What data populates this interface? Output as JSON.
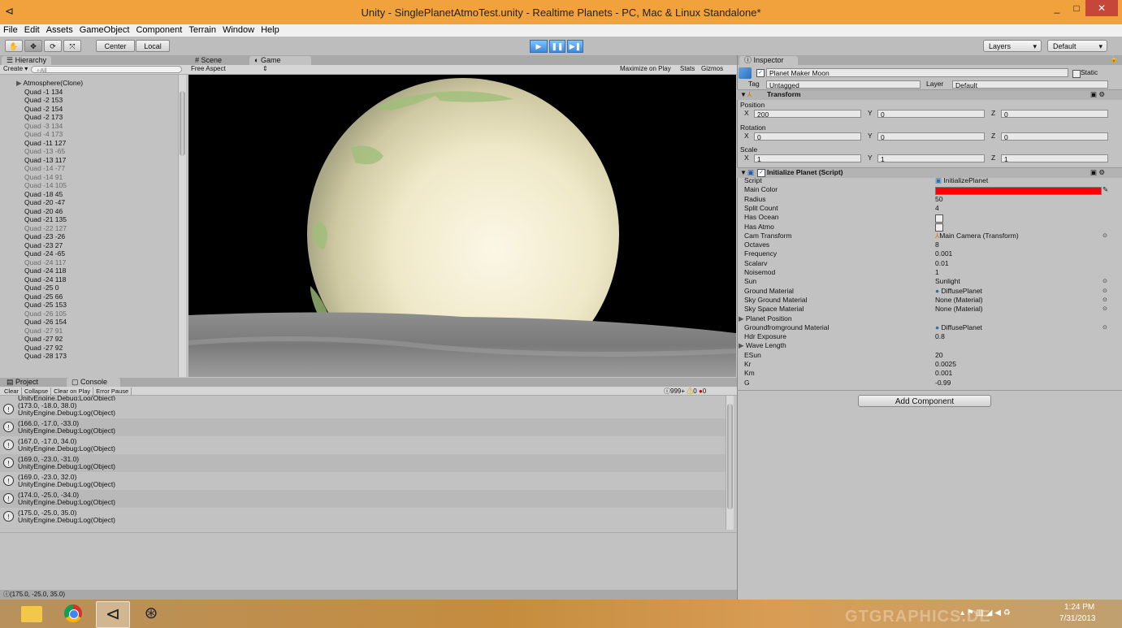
{
  "window": {
    "title": "Unity - SinglePlanetAtmoTest.unity - Realtime Planets - PC, Mac & Linux Standalone*",
    "minimize": "_",
    "maximize": "□",
    "close": "✕"
  },
  "menu": [
    "File",
    "Edit",
    "Assets",
    "GameObject",
    "Component",
    "Terrain",
    "Window",
    "Help"
  ],
  "toolbar": {
    "pivot": "Center",
    "space": "Local",
    "layers": "Layers",
    "layout": "Default",
    "play": "▶",
    "pause": "❚❚",
    "step": "▶❚"
  },
  "hierarchy": {
    "tab": "Hierarchy",
    "create": "Create",
    "search_placeholder": "All",
    "items": [
      {
        "label": "Atmosphere(Clone)",
        "dim": false,
        "foldout": true
      },
      {
        "label": "Quad -1 134",
        "dim": false
      },
      {
        "label": "Quad -2 153",
        "dim": false
      },
      {
        "label": "Quad -2 154",
        "dim": false
      },
      {
        "label": "Quad -2 173",
        "dim": false
      },
      {
        "label": "Quad -3 134",
        "dim": true
      },
      {
        "label": "Quad -4 173",
        "dim": true
      },
      {
        "label": "Quad -11 127",
        "dim": false
      },
      {
        "label": "Quad -13 -65",
        "dim": true
      },
      {
        "label": "Quad -13 117",
        "dim": false
      },
      {
        "label": "Quad -14 -77",
        "dim": true
      },
      {
        "label": "Quad -14 91",
        "dim": true
      },
      {
        "label": "Quad -14 105",
        "dim": true
      },
      {
        "label": "Quad -18 45",
        "dim": false
      },
      {
        "label": "Quad -20 -47",
        "dim": false
      },
      {
        "label": "Quad -20 46",
        "dim": false
      },
      {
        "label": "Quad -21 135",
        "dim": false
      },
      {
        "label": "Quad -22 127",
        "dim": true
      },
      {
        "label": "Quad -23 -26",
        "dim": false
      },
      {
        "label": "Quad -23 27",
        "dim": false
      },
      {
        "label": "Quad -24 -65",
        "dim": false
      },
      {
        "label": "Quad -24 117",
        "dim": true
      },
      {
        "label": "Quad -24 118",
        "dim": false
      },
      {
        "label": "Quad -24 118",
        "dim": false
      },
      {
        "label": "Quad -25 0",
        "dim": false
      },
      {
        "label": "Quad -25 66",
        "dim": false
      },
      {
        "label": "Quad -25 153",
        "dim": false
      },
      {
        "label": "Quad -26 105",
        "dim": true
      },
      {
        "label": "Quad -26 154",
        "dim": false
      },
      {
        "label": "Quad -27 91",
        "dim": true
      },
      {
        "label": "Quad -27 92",
        "dim": false
      },
      {
        "label": "Quad -27 92",
        "dim": false
      },
      {
        "label": "Quad -28 173",
        "dim": false
      }
    ]
  },
  "view_tabs": {
    "scene": "Scene",
    "game": "Game",
    "aspect": "Free Aspect",
    "maximize": "Maximize on Play",
    "stats": "Stats",
    "gizmos": "Gizmos"
  },
  "console": {
    "project_tab": "Project",
    "console_tab": "Console",
    "buttons": [
      "Clear",
      "Collapse",
      "Clear on Play",
      "Error Pause"
    ],
    "counts": {
      "logs": "999+",
      "warnings": "0",
      "errors": "0"
    },
    "entries": [
      {
        "l1": "(173.0, -18.0, 38.0)",
        "l2": "UnityEngine.Debug:Log(Object)"
      },
      {
        "l1": "(166.0, -17.0, -33.0)",
        "l2": "UnityEngine.Debug:Log(Object)"
      },
      {
        "l1": "(167.0, -17.0, 34.0)",
        "l2": "UnityEngine.Debug:Log(Object)"
      },
      {
        "l1": "(169.0, -23.0, -31.0)",
        "l2": "UnityEngine.Debug:Log(Object)"
      },
      {
        "l1": "(169.0, -23.0, 32.0)",
        "l2": "UnityEngine.Debug:Log(Object)"
      },
      {
        "l1": "(174.0, -25.0, -34.0)",
        "l2": "UnityEngine.Debug:Log(Object)"
      },
      {
        "l1": "(175.0, -25.0, 35.0)",
        "l2": "UnityEngine.Debug:Log(Object)"
      }
    ],
    "partial_top": "UnityEngine.Debug:Log(Object)",
    "status": "(175.0, -25.0, 35.0)"
  },
  "inspector": {
    "tab": "Inspector",
    "object_name": "Planet Maker Moon",
    "static": "Static",
    "tag_label": "Tag",
    "tag_value": "Untagged",
    "layer_label": "Layer",
    "layer_value": "Default",
    "transform": {
      "title": "Transform",
      "position_label": "Position",
      "rotation_label": "Rotation",
      "scale_label": "Scale",
      "position": {
        "x": "200",
        "y": "0",
        "z": "0"
      },
      "rotation": {
        "x": "0",
        "y": "0",
        "z": "0"
      },
      "scale": {
        "x": "1",
        "y": "1",
        "z": "1"
      }
    },
    "script": {
      "title": "Initialize Planet (Script)",
      "main_color": "#ff0000",
      "props": [
        {
          "label": "Script",
          "value": "InitializePlanet",
          "icon": "script-icon"
        },
        {
          "label": "Main Color",
          "value": ""
        },
        {
          "label": "Radius",
          "value": "50"
        },
        {
          "label": "Split Count",
          "value": "4"
        },
        {
          "label": "Has Ocean",
          "value": ""
        },
        {
          "label": "Has Atmo",
          "value": ""
        },
        {
          "label": "Cam Transform",
          "value": "Main Camera (Transform)",
          "icon": "transform-icon",
          "circle": true
        },
        {
          "label": "Octaves",
          "value": "8"
        },
        {
          "label": "Frequency",
          "value": "0.001"
        },
        {
          "label": "Scalarv",
          "value": "0.01"
        },
        {
          "label": "Noisemod",
          "value": "1"
        },
        {
          "label": "Sun",
          "value": "Sunlight",
          "circle": true
        },
        {
          "label": "Ground Material",
          "value": "DiffusePlanet",
          "icon": "material-icon",
          "circle": true
        },
        {
          "label": "Sky Ground Material",
          "value": "None (Material)",
          "circle": true
        },
        {
          "label": "Sky Space Material",
          "value": "None (Material)",
          "circle": true
        },
        {
          "label": "Planet Position",
          "value": "",
          "foldout": true
        },
        {
          "label": "Groundfromground Material",
          "value": "DiffusePlanet",
          "icon": "material-icon",
          "circle": true
        },
        {
          "label": "Hdr Exposure",
          "value": "0.8"
        },
        {
          "label": "Wave Length",
          "value": "",
          "foldout": true
        },
        {
          "label": "ESun",
          "value": "20"
        },
        {
          "label": "Kr",
          "value": "0.0025"
        },
        {
          "label": "Km",
          "value": "0.001"
        },
        {
          "label": "G",
          "value": "-0.99"
        }
      ]
    },
    "add_component": "Add Component"
  },
  "taskbar": {
    "time": "1:24 PM",
    "date": "7/31/2013",
    "watermark": "GTGRAPHICS.DE"
  }
}
